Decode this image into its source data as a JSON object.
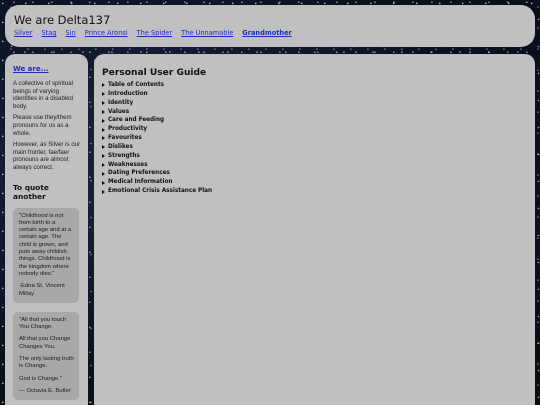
{
  "header": {
    "title": "We are Delta137",
    "nav": [
      {
        "label": "Silver",
        "bold": false
      },
      {
        "label": "Stag",
        "bold": false
      },
      {
        "label": "Sin",
        "bold": false
      },
      {
        "label": "Prince Aronsi",
        "bold": false
      },
      {
        "label": "The Spider",
        "bold": false
      },
      {
        "label": "The Unnamable",
        "bold": false
      },
      {
        "label": "Grandmother",
        "bold": true
      }
    ]
  },
  "sidebar": {
    "we_are_link": "We are...",
    "paragraphs": [
      "A collective of spiritual beings of varying identities in a disabled body.",
      "Please use they/them pronouns for us as a whole.",
      "However, as Silver is our main fronter, fae/faer pronouns are almost always correct."
    ],
    "quote_heading": "To quote another",
    "quotes": [
      {
        "lines": [
          "\"Childhood is not from birth to a certain age and at a certain age. The child is grown, and puts away childish things. Childhood is the kingdom where nobody dies.\"",
          "-Edna St. Vincent Millay"
        ]
      },
      {
        "lines": [
          "\"All that you touch You Change.",
          "All that you Change Changes You.",
          "The only lasting truth is Change.",
          "God is Change.\"",
          "— Octavia E. Butler"
        ]
      }
    ]
  },
  "main": {
    "title": "Personal User Guide",
    "sections": [
      "Table of Contents",
      "Introduction",
      "Identity",
      "Values",
      "Care and Feeding",
      "Productivity",
      "Favourites",
      "Dislikes",
      "Strengths",
      "Weaknesses",
      "Dating Preferences",
      "Medical Information",
      "Emotional Crisis Assistance Plan"
    ]
  }
}
